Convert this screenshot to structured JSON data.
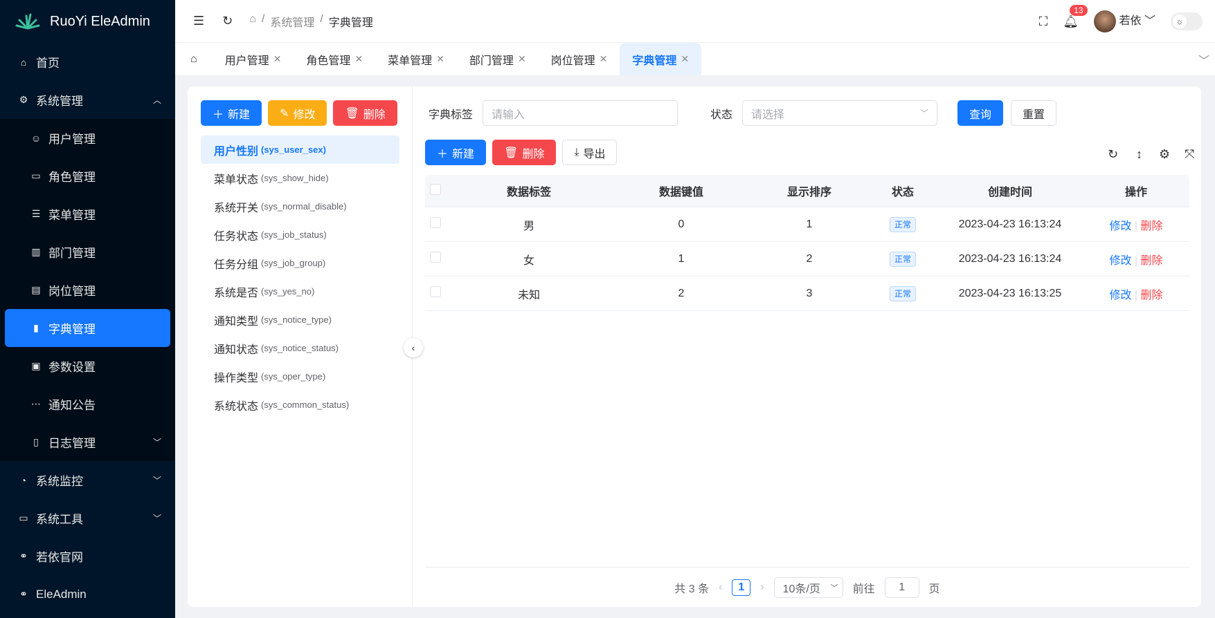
{
  "app": {
    "title": "RuoYi EleAdmin"
  },
  "sidebar": {
    "items": [
      {
        "label": "首页",
        "icon": "home-icon"
      },
      {
        "label": "系统管理",
        "icon": "gear-icon",
        "expanded": true,
        "children": [
          {
            "label": "用户管理",
            "icon": "user-icon"
          },
          {
            "label": "角色管理",
            "icon": "id-card-icon"
          },
          {
            "label": "菜单管理",
            "icon": "sliders-icon"
          },
          {
            "label": "部门管理",
            "icon": "building-icon"
          },
          {
            "label": "岗位管理",
            "icon": "briefcase-icon"
          },
          {
            "label": "字典管理",
            "icon": "book-icon",
            "active": true
          },
          {
            "label": "参数设置",
            "icon": "settings-card-icon"
          },
          {
            "label": "通知公告",
            "icon": "message-icon"
          },
          {
            "label": "日志管理",
            "icon": "log-icon"
          }
        ]
      },
      {
        "label": "系统监控",
        "icon": "dashboard-icon"
      },
      {
        "label": "系统工具",
        "icon": "toolbox-icon"
      },
      {
        "label": "若依官网",
        "icon": "link-icon"
      },
      {
        "label": "EleAdmin",
        "icon": "link-icon"
      }
    ]
  },
  "header": {
    "breadcrumb": [
      "系统管理",
      "字典管理"
    ],
    "notification_count": "13",
    "user_name": "若依"
  },
  "tabs": [
    "用户管理",
    "角色管理",
    "菜单管理",
    "部门管理",
    "岗位管理",
    "字典管理"
  ],
  "left_panel": {
    "new": "新建",
    "edit": "修改",
    "delete": "删除",
    "dicts": [
      {
        "name": "用户性别",
        "code": "(sys_user_sex)"
      },
      {
        "name": "菜单状态",
        "code": "(sys_show_hide)"
      },
      {
        "name": "系统开关",
        "code": "(sys_normal_disable)"
      },
      {
        "name": "任务状态",
        "code": "(sys_job_status)"
      },
      {
        "name": "任务分组",
        "code": "(sys_job_group)"
      },
      {
        "name": "系统是否",
        "code": "(sys_yes_no)"
      },
      {
        "name": "通知类型",
        "code": "(sys_notice_type)"
      },
      {
        "name": "通知状态",
        "code": "(sys_notice_status)"
      },
      {
        "name": "操作类型",
        "code": "(sys_oper_type)"
      },
      {
        "name": "系统状态",
        "code": "(sys_common_status)"
      }
    ]
  },
  "search": {
    "label_label": "字典标签",
    "label_placeholder": "请输入",
    "status_label": "状态",
    "status_placeholder": "请选择",
    "query": "查询",
    "reset": "重置"
  },
  "toolbar": {
    "new": "新建",
    "delete": "删除",
    "export": "导出"
  },
  "table": {
    "headers": [
      "数据标签",
      "数据键值",
      "显示排序",
      "状态",
      "创建时间",
      "操作"
    ],
    "rows": [
      {
        "label": "男",
        "value": "0",
        "sort": "1",
        "status": "正常",
        "time": "2023-04-23 16:13:24"
      },
      {
        "label": "女",
        "value": "1",
        "sort": "2",
        "status": "正常",
        "time": "2023-04-23 16:13:24"
      },
      {
        "label": "未知",
        "value": "2",
        "sort": "3",
        "status": "正常",
        "time": "2023-04-23 16:13:25"
      }
    ],
    "edit": "修改",
    "delete": "删除"
  },
  "pagination": {
    "total": "共 3 条",
    "page": "1",
    "size": "10条/页",
    "goto": "前往",
    "goto_value": "1",
    "page_suffix": "页"
  }
}
